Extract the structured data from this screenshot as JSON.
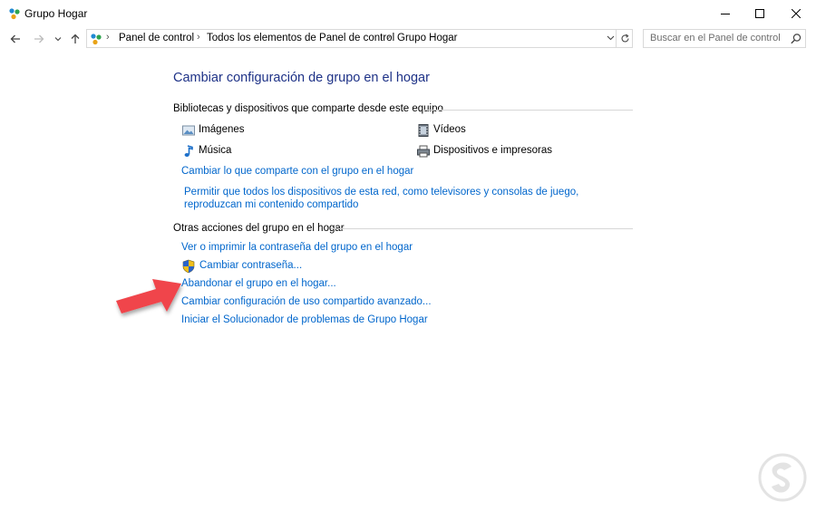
{
  "window": {
    "title": "Grupo Hogar"
  },
  "address": {
    "crumbs": [
      "Panel de control",
      "Todos los elementos de Panel de control",
      "Grupo Hogar"
    ]
  },
  "search": {
    "placeholder": "Buscar en el Panel de control"
  },
  "main": {
    "title": "Cambiar configuración de grupo en el hogar",
    "shared_section": {
      "heading": "Bibliotecas y dispositivos que comparte desde este equipo",
      "items": [
        {
          "label": "Imágenes",
          "icon": "pictures-icon"
        },
        {
          "label": "Vídeos",
          "icon": "videos-icon"
        },
        {
          "label": "Música",
          "icon": "music-icon"
        },
        {
          "label": "Dispositivos e impresoras",
          "icon": "printer-icon"
        }
      ],
      "links": [
        "Cambiar lo que comparte con el grupo en el hogar",
        "Permitir que todos los dispositivos de esta red, como televisores y consolas de juego, reproduzcan mi contenido compartido"
      ]
    },
    "other_section": {
      "heading": "Otras acciones del grupo en el hogar",
      "links": [
        "Ver o imprimir la contraseña del grupo en el hogar",
        "Cambiar contraseña...",
        "Abandonar el grupo en el hogar...",
        "Cambiar configuración de uso compartido avanzado...",
        "Iniciar el Solucionador de problemas de Grupo Hogar"
      ]
    }
  },
  "colors": {
    "title_blue": "#1e3287",
    "link_blue": "#0066cc",
    "arrow_red": "#f0454b"
  }
}
